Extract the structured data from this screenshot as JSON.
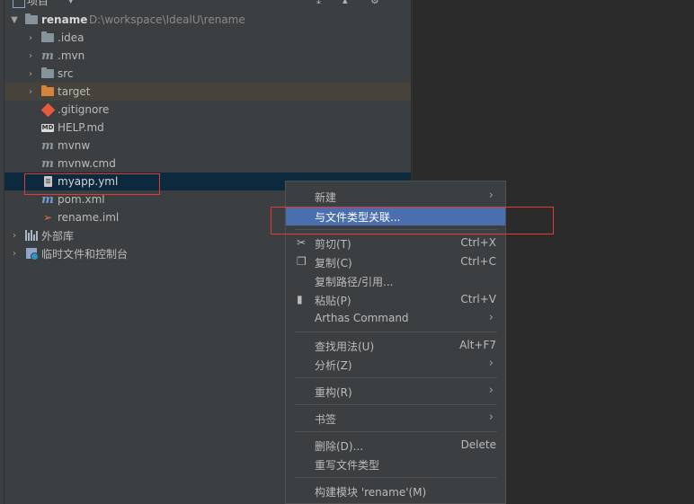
{
  "header": {
    "title": "项目"
  },
  "tree": {
    "root": {
      "name": "rename",
      "path": "D:\\workspace\\IdealU\\rename"
    },
    "items": [
      {
        "label": ".idea",
        "icon": "folder-icon"
      },
      {
        "label": ".mvn",
        "icon": "maven-icon"
      },
      {
        "label": "src",
        "icon": "folder-icon"
      },
      {
        "label": "target",
        "icon": "folder-orange-icon"
      },
      {
        "label": ".gitignore",
        "icon": "git-icon"
      },
      {
        "label": "HELP.md",
        "icon": "markdown-icon"
      },
      {
        "label": "mvnw",
        "icon": "maven-icon"
      },
      {
        "label": "mvnw.cmd",
        "icon": "maven-icon"
      },
      {
        "label": "myapp.yml",
        "icon": "yaml-file-icon"
      },
      {
        "label": "pom.xml",
        "icon": "maven-icon"
      },
      {
        "label": "rename.iml",
        "icon": "iml-icon"
      }
    ],
    "external_libs": "外部库",
    "scratches": "临时文件和控制台"
  },
  "context_menu": {
    "new": "新建",
    "associate": "与文件类型关联...",
    "cut": {
      "label": "剪切(T)",
      "shortcut": "Ctrl+X"
    },
    "copy": {
      "label": "复制(C)",
      "shortcut": "Ctrl+C"
    },
    "copy_path": "复制路径/引用...",
    "paste": {
      "label": "粘贴(P)",
      "shortcut": "Ctrl+V"
    },
    "arthas": "Arthas Command",
    "find_usages": {
      "label": "查找用法(U)",
      "shortcut": "Alt+F7"
    },
    "analyze": "分析(Z)",
    "refactor": "重构(R)",
    "bookmarks": "书签",
    "delete": {
      "label": "删除(D)...",
      "shortcut": "Delete"
    },
    "override_type": "重写文件类型",
    "build_module": "构建模块 'rename'(M)"
  },
  "colors": {
    "selection": "#4b6eaf",
    "highlight_box": "#e53935",
    "panel": "#3c3f41"
  }
}
